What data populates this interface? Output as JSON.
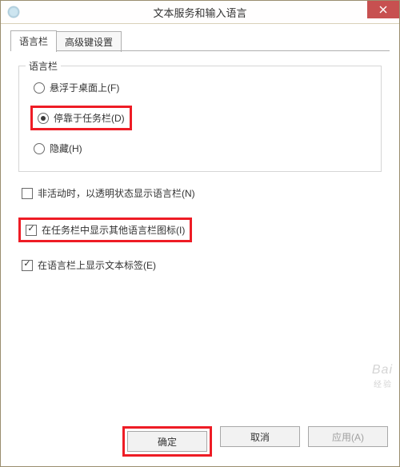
{
  "window": {
    "title": "文本服务和输入语言"
  },
  "tabs": {
    "items": [
      {
        "label": "语言栏"
      },
      {
        "label": "高级键设置"
      }
    ]
  },
  "group": {
    "legend": "语言栏",
    "radios": {
      "float": "悬浮于桌面上(F)",
      "dock": "停靠于任务栏(D)",
      "hide": "隐藏(H)"
    }
  },
  "checks": {
    "transparent": "非活动时，以透明状态显示语言栏(N)",
    "taskbar_icons": "在任务栏中显示其他语言栏图标(I)",
    "text_labels": "在语言栏上显示文本标签(E)"
  },
  "buttons": {
    "ok": "确定",
    "cancel": "取消",
    "apply": "应用(A)"
  },
  "watermark": {
    "brand": "Bai",
    "sub": "经验"
  }
}
